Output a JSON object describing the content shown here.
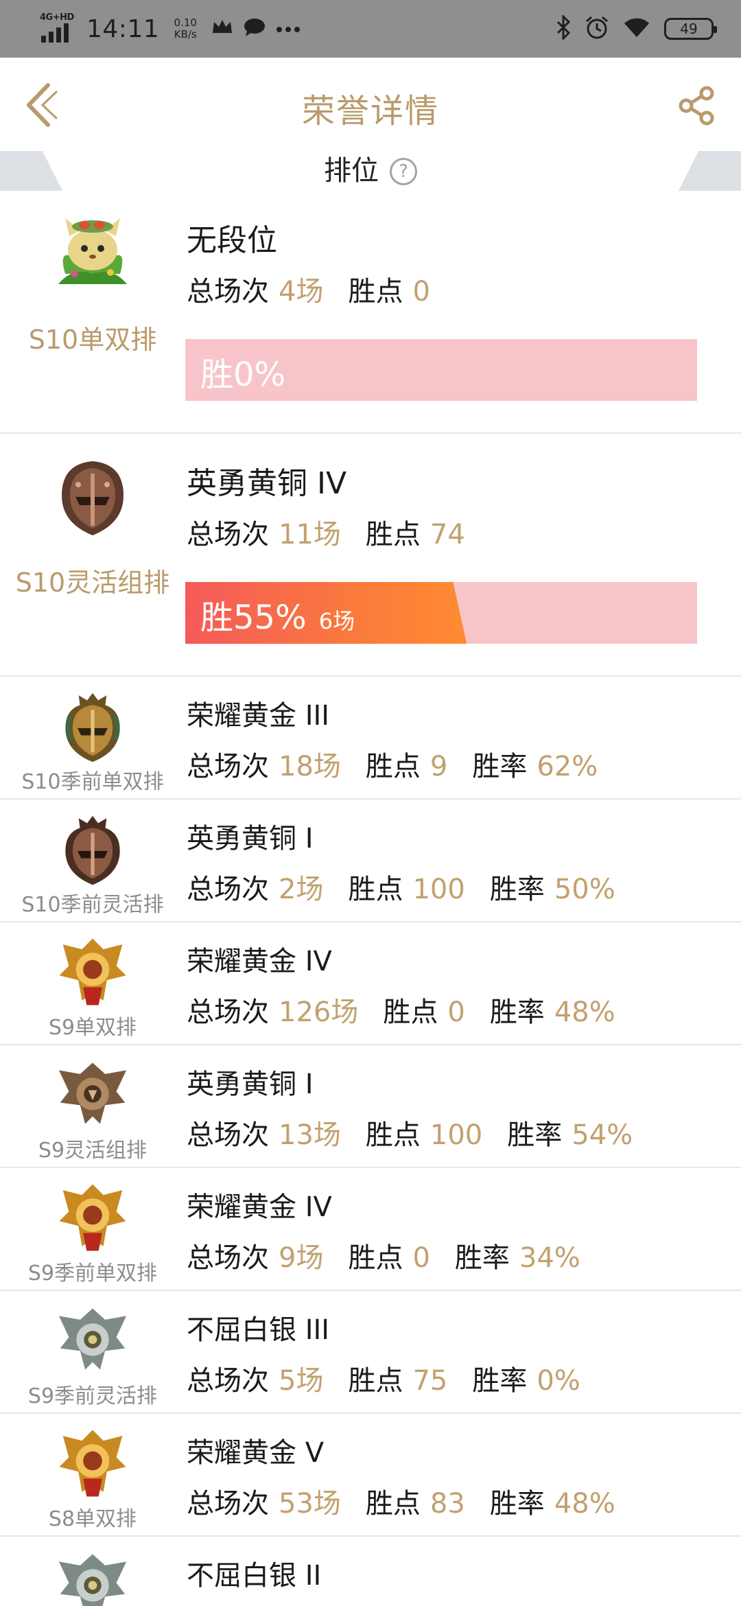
{
  "status_bar": {
    "network": "4G+HD",
    "time": "14:11",
    "speed_value": "0.10",
    "speed_unit": "KB/s",
    "battery": "49",
    "icons": [
      "crown-icon",
      "chat-bubble-icon",
      "more-dots-icon",
      "bluetooth-icon",
      "alarm-icon",
      "wifi-icon"
    ]
  },
  "header": {
    "title": "荣誉详情",
    "back_icon": "back-chevron-icon",
    "share_icon": "share-icon"
  },
  "section": {
    "title": "排位",
    "help": "?"
  },
  "colors": {
    "accent": "#b99a6b",
    "value": "#c2a16f",
    "bar_bg": "#f7c5c9",
    "bar_fill_start": "#f55a5a",
    "bar_fill_end": "#ff8b32"
  },
  "featured": [
    {
      "mode": "S10单双排",
      "rank": "无段位",
      "emblem": "teemo-avatar-icon",
      "total_label": "总场次",
      "total": "4场",
      "points_label": "胜点",
      "points": "0",
      "win_text": "胜0%",
      "win_fraction": 0.0,
      "win_games": ""
    },
    {
      "mode": "S10灵活组排",
      "rank": "英勇黄铜 IV",
      "emblem": "bronze-helmet-icon",
      "total_label": "总场次",
      "total": "11场",
      "points_label": "胜点",
      "points": "74",
      "win_text": "胜55%",
      "win_fraction": 0.55,
      "win_games": "6场"
    }
  ],
  "history": [
    {
      "mode": "S10季前单双排",
      "rank": "荣耀黄金 III",
      "emblem": "gold-helmet-icon",
      "total": "18场",
      "points": "9",
      "rate": "62%"
    },
    {
      "mode": "S10季前灵活排",
      "rank": "英勇黄铜 I",
      "emblem": "bronze-helmet-icon",
      "total": "2场",
      "points": "100",
      "rate": "50%"
    },
    {
      "mode": "S9单双排",
      "rank": "荣耀黄金 IV",
      "emblem": "gold-crest-icon",
      "total": "126场",
      "points": "0",
      "rate": "48%"
    },
    {
      "mode": "S9灵活组排",
      "rank": "英勇黄铜 I",
      "emblem": "bronze-crest-icon",
      "total": "13场",
      "points": "100",
      "rate": "54%"
    },
    {
      "mode": "S9季前单双排",
      "rank": "荣耀黄金 IV",
      "emblem": "gold-crest-icon",
      "total": "9场",
      "points": "0",
      "rate": "34%"
    },
    {
      "mode": "S9季前灵活排",
      "rank": "不屈白银 III",
      "emblem": "silver-crest-icon",
      "total": "5场",
      "points": "75",
      "rate": "0%"
    },
    {
      "mode": "S8单双排",
      "rank": "荣耀黄金 V",
      "emblem": "gold-crest-icon",
      "total": "53场",
      "points": "83",
      "rate": "48%"
    },
    {
      "mode": "",
      "rank": "不屈白银 II",
      "emblem": "silver-crest-icon",
      "total": "",
      "points": "",
      "rate": ""
    }
  ],
  "labels": {
    "total": "总场次",
    "points": "胜点",
    "rate": "胜率"
  }
}
